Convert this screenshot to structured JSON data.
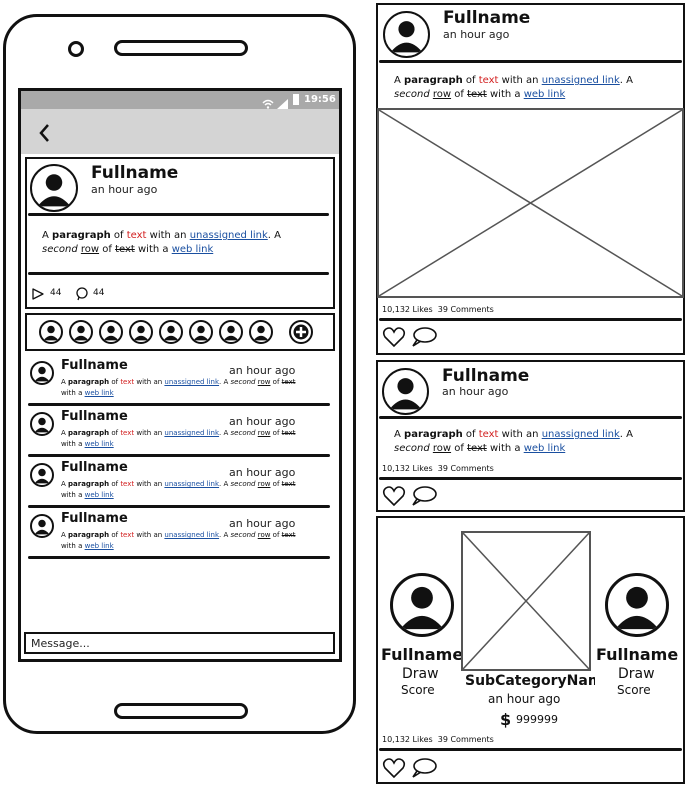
{
  "phone": {
    "status_time": "19:56",
    "post": {
      "name": "Fullname",
      "time": "an hour ago",
      "para": {
        "t1": "A ",
        "bold": "paragraph",
        "t2": " of ",
        "red": "text",
        "t3": " with an ",
        "link1": "unassigned link",
        "t4": ". A ",
        "ital": "second",
        "t5": " ",
        "und": "row",
        "t6": " of ",
        "strike": "text",
        "t7": " with a ",
        "link2": "web link"
      },
      "likes": "44",
      "comments": "44"
    },
    "comments": [
      {
        "name": "Fullname",
        "time": "an hour ago"
      },
      {
        "name": "Fullname",
        "time": "an hour ago"
      },
      {
        "name": "Fullname",
        "time": "an hour ago"
      },
      {
        "name": "Fullname",
        "time": "an hour ago"
      }
    ],
    "comment_para": {
      "t1": "A ",
      "bold": "paragraph",
      "t2": " of ",
      "red": "text",
      "t3": " with an ",
      "link1": "unassigned link",
      "t4": ". A ",
      "ital": "second",
      "t5": " ",
      "und": "row",
      "t6": " of ",
      "strike": "text",
      "t7": " with a ",
      "link2": "web link"
    },
    "message_placeholder": "Message..."
  },
  "cards": {
    "c1": {
      "name": "Fullname",
      "time": "an hour ago",
      "stats": "10,132 Likes  39 Comments"
    },
    "c2": {
      "name": "Fullname",
      "time": "an hour ago",
      "stats": "10,132 Likes  39 Comments"
    },
    "c3": {
      "left": {
        "name": "Fullname",
        "line1": "Draw",
        "line2": "Score"
      },
      "right": {
        "name": "Fullname",
        "line1": "Draw",
        "line2": "Score"
      },
      "subcategory": "SubCategoryNam",
      "time": "an hour ago",
      "price_symbol": "$",
      "price": "999999",
      "stats": "10,132 Likes  39 Comments"
    },
    "para": {
      "t1": "A ",
      "bold": "paragraph",
      "t2": " of ",
      "red": "text",
      "t3": " with an ",
      "link1": "unassigned link",
      "t4": ". A ",
      "ital": "second",
      "t5": " ",
      "und": "row",
      "t6": " of ",
      "strike": "text",
      "t7": " with a ",
      "link2": "web link"
    }
  }
}
